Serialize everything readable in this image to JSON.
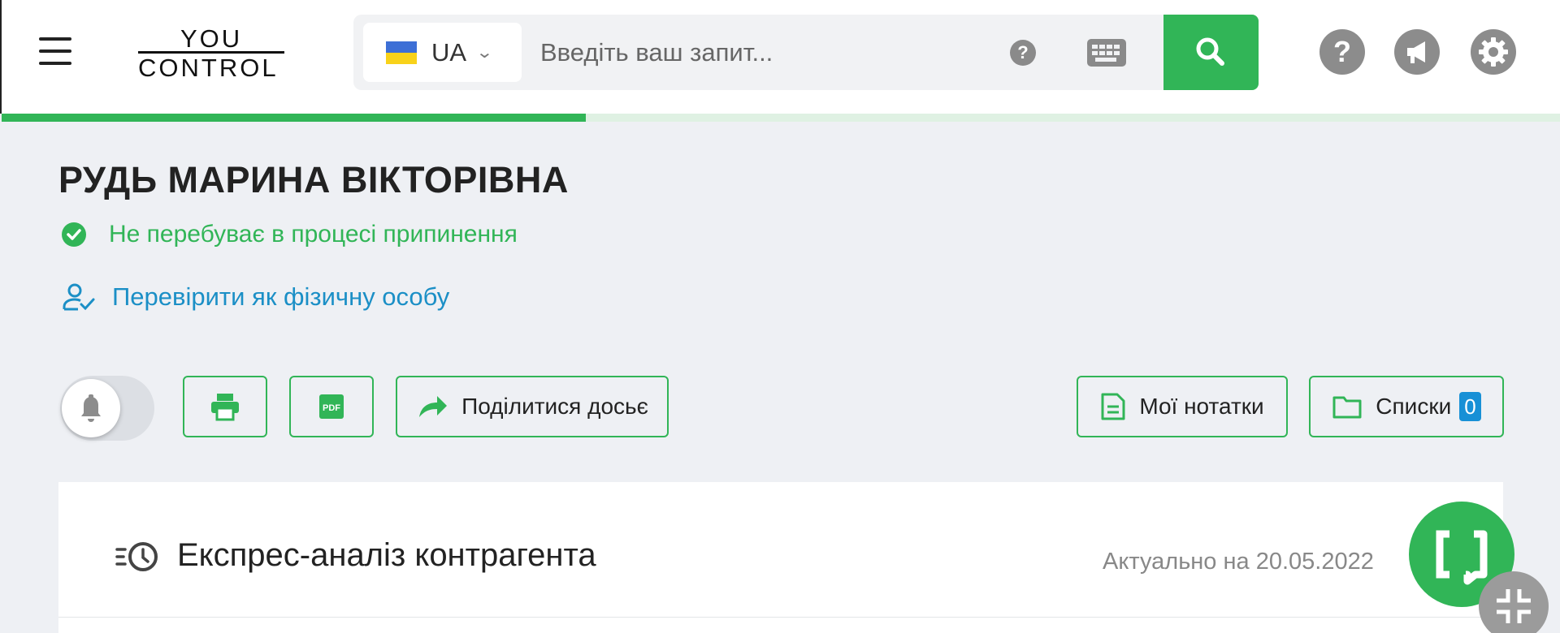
{
  "header": {
    "logo_top": "YOU",
    "logo_bottom": "CONTROL",
    "language": "UA",
    "search_placeholder": "Введіть ваш запит...",
    "help_small": "?",
    "icons": [
      "menu-icon",
      "chevron-down-icon",
      "question-icon",
      "keyboard-icon",
      "search-icon",
      "help-icon",
      "megaphone-icon",
      "gear-icon"
    ]
  },
  "progress": {
    "fraction": 0.375,
    "color": "#31b557"
  },
  "person": {
    "name": "РУДЬ МАРИНА ВІКТОРІВНА",
    "status": "Не перебуває в процесі припинення",
    "verify_link": "Перевірити як фізичну особу"
  },
  "toolbar": {
    "share_label": "Поділитися досьє",
    "notes_label": "Мої нотатки",
    "lists_label": "Списки",
    "lists_count": "0"
  },
  "card": {
    "title": "Експрес-аналіз контрагента",
    "date": "Актуально на 20.05.2022"
  },
  "colors": {
    "accent": "#31b557",
    "link": "#1b8fc6",
    "badge": "#1790d6"
  }
}
